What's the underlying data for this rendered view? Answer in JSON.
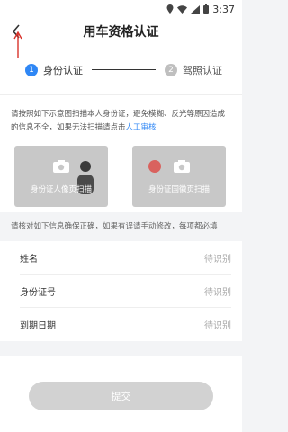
{
  "status": {
    "time": "3:37"
  },
  "header": {
    "title": "用车资格认证"
  },
  "stepper": {
    "steps": [
      {
        "num": "1",
        "label": "身份认证"
      },
      {
        "num": "2",
        "label": "驾照认证"
      }
    ]
  },
  "notice": {
    "text_before": "请按照如下示意图扫描本人身份证，避免模糊、反光等原因造成的信息不全，如果无法扫描请点击",
    "link": "人工审核"
  },
  "cards": {
    "front_label": "身份证人像页扫描",
    "back_label": "身份证国徽页扫描"
  },
  "hint": "请核对如下信息确保正确，如果有误请手动修改，每项都必填",
  "form": {
    "rows": [
      {
        "label": "姓名",
        "placeholder": "待识别"
      },
      {
        "label": "身份证号",
        "placeholder": "待识别"
      },
      {
        "label": "到期日期",
        "placeholder": "待识别"
      }
    ]
  },
  "submit_label": "提交",
  "colors": {
    "accent": "#2f87f5",
    "annotation_arrow": "#d9322b"
  }
}
